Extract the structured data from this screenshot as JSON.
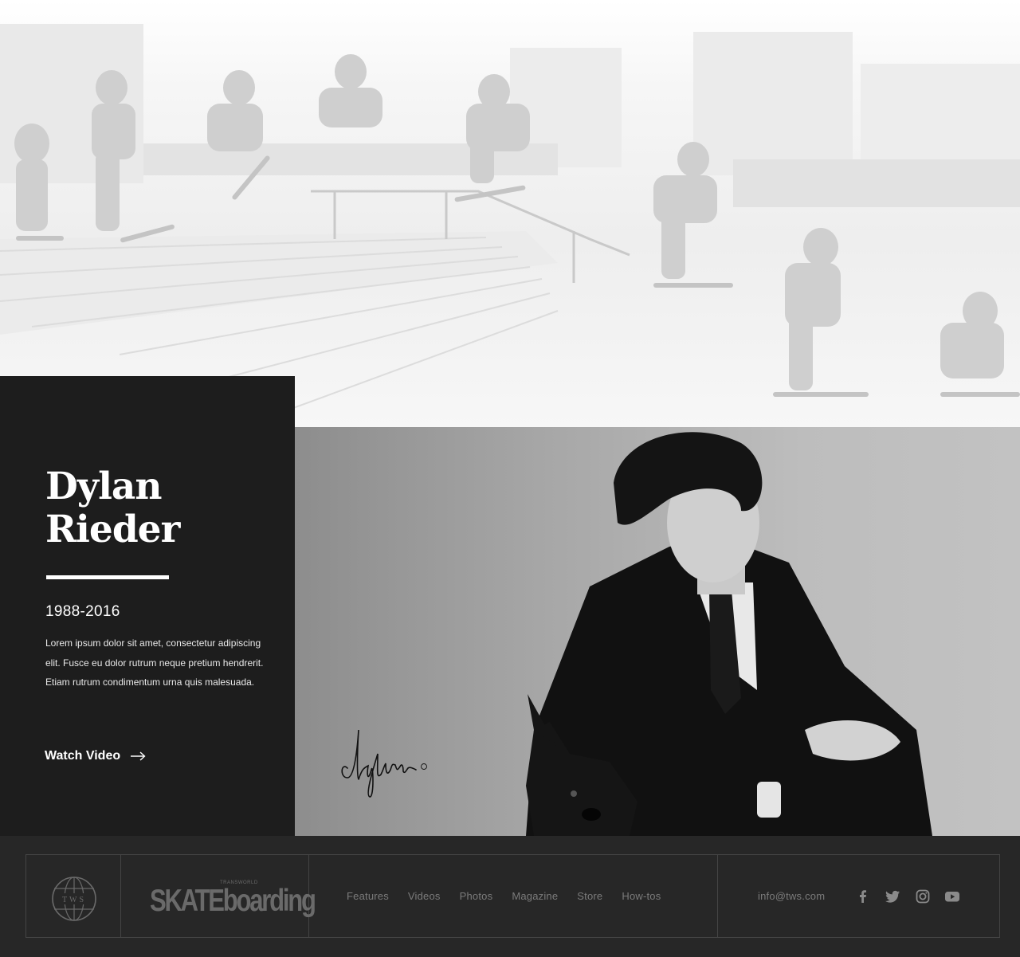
{
  "hero": {
    "image": "skate-sequence-photo"
  },
  "bio": {
    "first_name": "Dylan",
    "last_name": "Rieder",
    "years": "1988-2016",
    "description": "Lorem ipsum dolor sit amet, consectetur adipiscing elit. Fusce eu dolor rutrum neque pretium hendrerit. Etiam rutrum condimentum urna quis malesuada.",
    "cta_label": "Watch Video",
    "cta_icon": "arrow-right-icon"
  },
  "portrait": {
    "image": "portrait-photo",
    "signature": "dylan"
  },
  "footer": {
    "globe_logo_text": "TWS",
    "brand_word": "SKATEboarding",
    "brand_super": "TRANSWORLD",
    "nav": [
      "Features",
      "Videos",
      "Photos",
      "Magazine",
      "Store",
      "How-tos"
    ],
    "email": "info@tws.com",
    "social_icons": [
      "facebook-icon",
      "twitter-icon",
      "instagram-icon",
      "youtube-icon"
    ]
  },
  "colors": {
    "panel": "#1d1d1d",
    "footer": "#272727",
    "footer_text": "#7b7b7b",
    "white": "#ffffff"
  }
}
